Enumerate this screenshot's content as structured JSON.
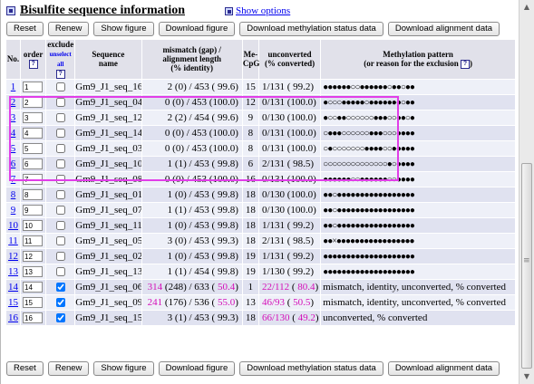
{
  "header": {
    "title": "Bisulfite sequence information",
    "show_options": "Show options"
  },
  "buttons": {
    "reset": "Reset",
    "renew": "Renew",
    "show_figure": "Show figure",
    "download_figure": "Download figure",
    "download_methylation": "Download methylation status data",
    "download_alignment": "Download alignment data"
  },
  "table": {
    "headers": {
      "no": "No.",
      "order": "order",
      "exclude": "exclude",
      "unselect_all": "unselect all",
      "sequence_name_1": "Sequence",
      "sequence_name_2": "name",
      "mismatch_1": "mismatch (gap) /",
      "mismatch_2": "alignment length",
      "mismatch_3": "(% identity)",
      "mecpg_1": "Me-",
      "mecpg_2": "CpG",
      "unconverted_1": "unconverted",
      "unconverted_2": "(% converted)",
      "pattern_1": "Methylation pattern",
      "pattern_2": "(or reason for the exclusion"
    },
    "rows": [
      {
        "no": "1",
        "order": "1",
        "excluded": false,
        "name": "Gm9_J1_seq_16",
        "mismatch": "2 (0) / 453 ( 99.6)",
        "mecpg": "15",
        "unconverted": "1/131 ( 99.2)",
        "pattern": "●●●●●●○○●●●●●●○●●○●●"
      },
      {
        "no": "2",
        "order": "2",
        "excluded": false,
        "name": "Gm9_J1_seq_04",
        "mismatch": "0 (0) / 453 (100.0)",
        "mecpg": "12",
        "unconverted": "0/131 (100.0)",
        "pattern": "●○○○●●●●●○●●●●●●●○●●"
      },
      {
        "no": "3",
        "order": "3",
        "excluded": false,
        "name": "Gm9_J1_seq_12",
        "mismatch": "2 (2) / 454 ( 99.6)",
        "mecpg": "9",
        "unconverted": "0/130 (100.0)",
        "pattern": "●○○●●○○○○○○●●●○○●●○●"
      },
      {
        "no": "4",
        "order": "4",
        "excluded": false,
        "name": "Gm9_J1_seq_14",
        "mismatch": "0 (0) / 453 (100.0)",
        "mecpg": "8",
        "unconverted": "0/131 (100.0)",
        "pattern": "○●●●○○○○○○●●●○○○●●●●"
      },
      {
        "no": "5",
        "order": "5",
        "excluded": false,
        "name": "Gm9_J1_seq_03",
        "mismatch": "0 (0) / 453 (100.0)",
        "mecpg": "8",
        "unconverted": "0/131 (100.0)",
        "pattern": "○●○○○○○○○●●●●○○●●●●●"
      },
      {
        "no": "6",
        "order": "6",
        "excluded": false,
        "name": "Gm9_J1_seq_10",
        "mismatch": "1 (1) / 453 ( 99.8)",
        "mecpg": "6",
        "unconverted": "2/131 ( 98.5)",
        "pattern": "○○○○○○○○○○○○○○●○●●●●"
      },
      {
        "no": "7",
        "order": "7",
        "excluded": false,
        "name": "Gm9_J1_seq_08",
        "mismatch": "0 (0) / 453 (100.0)",
        "mecpg": "16",
        "unconverted": "0/131 (100.0)",
        "pattern": "●●●●●●○○●●●●●●○○●●●●"
      },
      {
        "no": "8",
        "order": "8",
        "excluded": false,
        "name": "Gm9_J1_seq_01",
        "mismatch": "1 (0) / 453 ( 99.8)",
        "mecpg": "18",
        "unconverted": "0/130 (100.0)",
        "pattern": "●●○●●●●●●●●●●●●●●●●●"
      },
      {
        "no": "9",
        "order": "9",
        "excluded": false,
        "name": "Gm9_J1_seq_07",
        "mismatch": "1 (1) / 453 ( 99.8)",
        "mecpg": "18",
        "unconverted": "0/130 (100.0)",
        "pattern": "●●○●●●●●●●●●●●●●●●●●"
      },
      {
        "no": "10",
        "order": "10",
        "excluded": false,
        "name": "Gm9_J1_seq_11",
        "mismatch": "1 (0) / 453 ( 99.8)",
        "mecpg": "18",
        "unconverted": "1/131 ( 99.2)",
        "pattern": "●●○●●●●●●●●●●●●●●●●●"
      },
      {
        "no": "11",
        "order": "11",
        "excluded": false,
        "name": "Gm9_J1_seq_05",
        "mismatch": "3 (0) / 453 ( 99.3)",
        "mecpg": "18",
        "unconverted": "2/131 ( 98.5)",
        "pattern": "●●×●●●●●●●●●●●●●●●●●"
      },
      {
        "no": "12",
        "order": "12",
        "excluded": false,
        "name": "Gm9_J1_seq_02",
        "mismatch": "1 (0) / 453 ( 99.8)",
        "mecpg": "19",
        "unconverted": "1/131 ( 99.2)",
        "pattern": "●●●●●●●●●●●●●●●●●●●●"
      },
      {
        "no": "13",
        "order": "13",
        "excluded": false,
        "name": "Gm9_J1_seq_13",
        "mismatch": "1 (1) / 454 ( 99.8)",
        "mecpg": "19",
        "unconverted": "1/130 ( 99.2)",
        "pattern": "●●●●●●●●●●●●●●●●●●●●"
      },
      {
        "no": "14",
        "order": "14",
        "excluded": true,
        "name": "Gm9_J1_seq_06",
        "mismatch_hl": "314",
        "mismatch_mid": " (248) / 633 (",
        "mismatch_hl2": " 50.4",
        "mismatch_end": ")",
        "mecpg": "1",
        "unconverted_hl": "22/112",
        "unconverted_mid": " (",
        "unconverted_hl2": " 80.4",
        "unconverted_end": ")",
        "pattern": "mismatch, identity, unconverted, % converted"
      },
      {
        "no": "15",
        "order": "15",
        "excluded": true,
        "name": "Gm9_J1_seq_09",
        "mismatch_hl": "241",
        "mismatch_mid": " (176) / 536 (",
        "mismatch_hl2": " 55.0",
        "mismatch_end": ")",
        "mecpg": "13",
        "unconverted_hl": "46/93",
        "unconverted_mid": " (",
        "unconverted_hl2": " 50.5",
        "unconverted_end": ")",
        "pattern": "mismatch, identity, unconverted, % converted"
      },
      {
        "no": "16",
        "order": "16",
        "excluded": true,
        "name": "Gm9_J1_seq_15",
        "mismatch": "3 (1) / 453 ( 99.3)",
        "mecpg": "18",
        "unconverted_hl": "66/130",
        "unconverted_mid": " (",
        "unconverted_hl2": " 49.2",
        "unconverted_end": ")",
        "pattern": "unconverted, % converted"
      }
    ]
  },
  "colors": {
    "highlight_border": "#e13ee8",
    "warning_text": "#d40fb8",
    "row_odd": "#eef0f8",
    "row_even": "#e0e2f0",
    "header_bg": "#e1e1ea",
    "link": "#0000ee"
  },
  "icons": [
    "panel-toggle-icon",
    "show-options-icon",
    "help-icon",
    "scroll-up-icon",
    "scroll-down-icon"
  ]
}
